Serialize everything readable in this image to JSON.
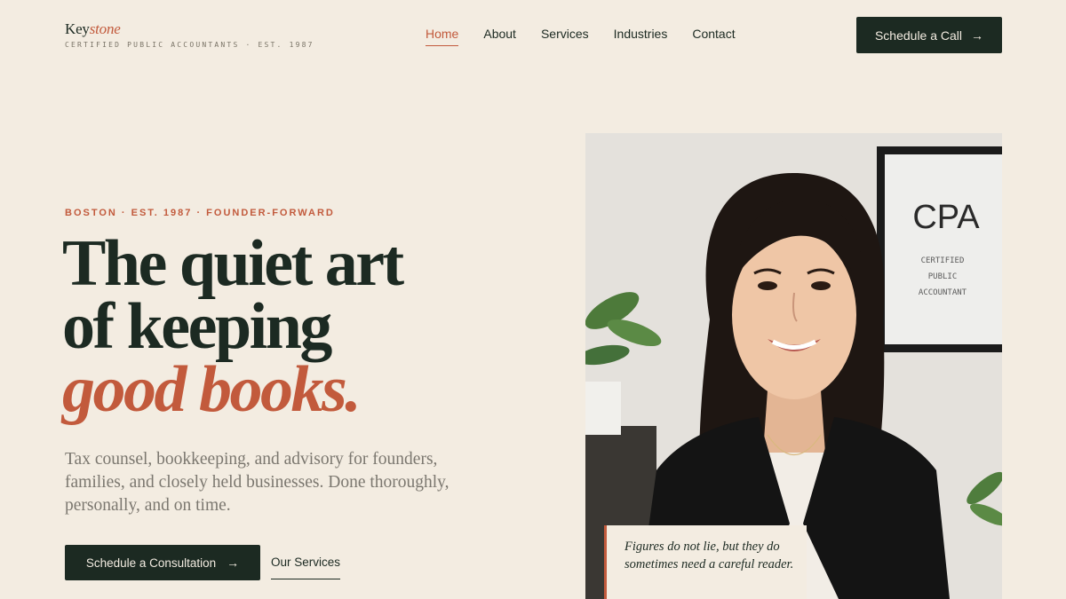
{
  "brand": {
    "name_plain": "Key",
    "name_accent": "stone",
    "tagline": "CERTIFIED PUBLIC ACCOUNTANTS · EST. 1987"
  },
  "nav": {
    "items": [
      {
        "label": "Home",
        "active": true
      },
      {
        "label": "About"
      },
      {
        "label": "Services"
      },
      {
        "label": "Industries"
      },
      {
        "label": "Contact"
      }
    ],
    "cta_label": "Schedule a Call",
    "cta_icon": "arrow-right-icon"
  },
  "hero": {
    "eyebrow": "BOSTON · EST. 1987 · FOUNDER-FORWARD",
    "headline_line1": "The quiet art",
    "headline_line2": "of keeping",
    "headline_accent": "good books.",
    "lede": "Tax counsel, bookkeeping, and advisory for founders, families, and closely held businesses. Done thoroughly, personally, and on time.",
    "primary_cta": "Schedule a Consultation",
    "secondary_cta": "Our Services",
    "quote": "Figures do not lie, but they do sometimes need a careful reader."
  },
  "photo": {
    "sign_title": "CPA",
    "sign_line1": "CERTIFIED",
    "sign_line2": "PUBLIC",
    "sign_line3": "ACCOUNTANT"
  },
  "colors": {
    "background": "#f3ece1",
    "ink": "#1c2a22",
    "accent": "#c25a3c",
    "muted": "#7b776f"
  }
}
